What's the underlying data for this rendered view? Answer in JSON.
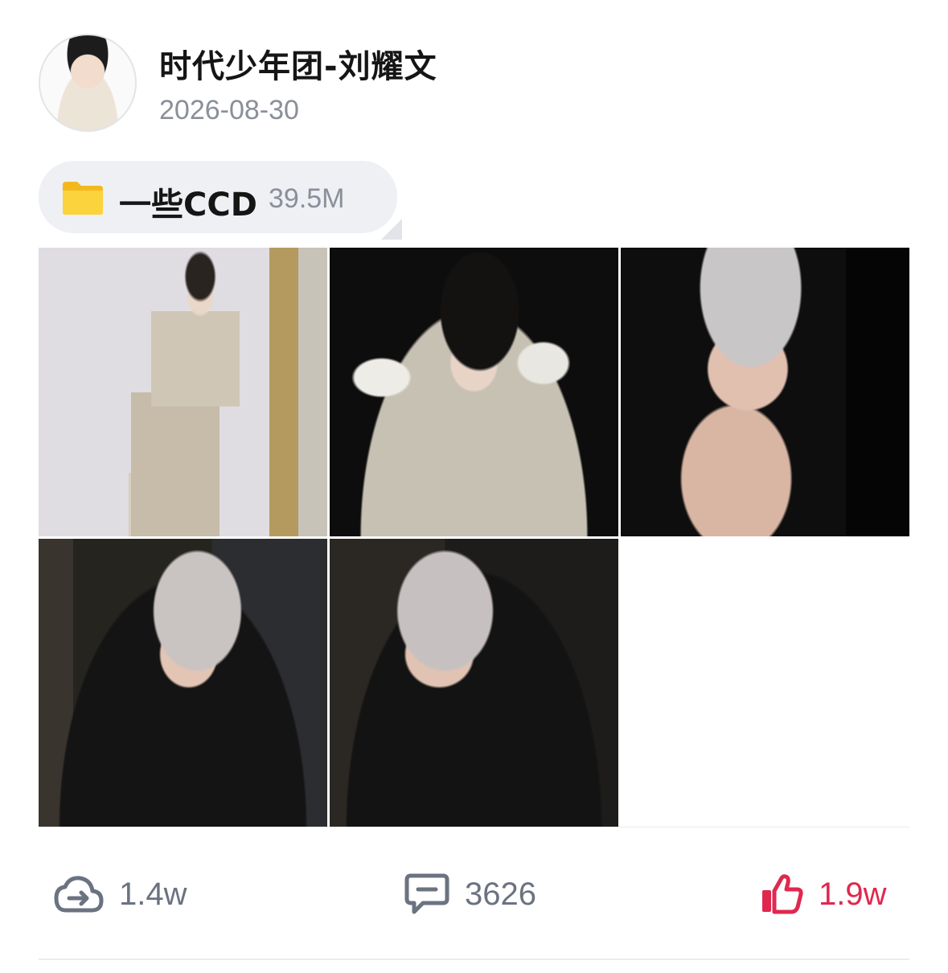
{
  "post": {
    "author_name": "时代少年团-刘耀文",
    "date": "2026-08-30"
  },
  "attachment": {
    "icon": "folder-icon",
    "name": "一些CCD",
    "size": "39.5M"
  },
  "photos": [
    {
      "name": "photo-1"
    },
    {
      "name": "photo-2"
    },
    {
      "name": "photo-3"
    },
    {
      "name": "photo-4"
    },
    {
      "name": "photo-5"
    }
  ],
  "actions": {
    "share": {
      "icon": "cloud-share-icon",
      "count": "1.4w"
    },
    "comment": {
      "icon": "comment-icon",
      "count": "3626"
    },
    "like": {
      "icon": "thumbs-up-icon",
      "count": "1.9w",
      "color": "#e0284f"
    }
  },
  "colors": {
    "muted_text": "#8a8f99",
    "icon_gray": "#6b7280",
    "like_red": "#e0284f",
    "pill_bg": "#eef0f4",
    "folder_yellow": "#f7c52f"
  }
}
